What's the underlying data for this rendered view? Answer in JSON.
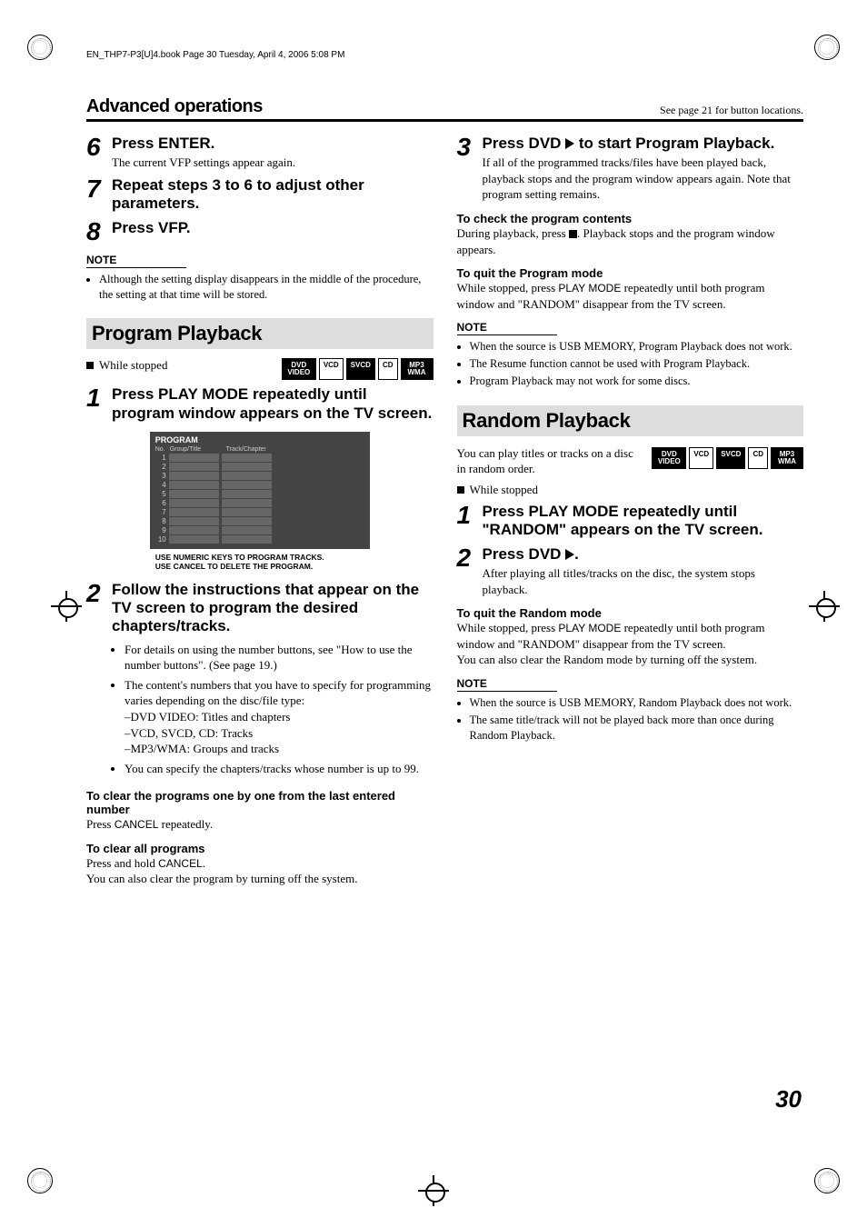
{
  "top_header": "EN_THP7-P3[U]4.book  Page 30  Tuesday, April 4, 2006  5:08 PM",
  "header": {
    "left": "Advanced operations",
    "right": "See page 21 for button locations."
  },
  "left_col": {
    "step6": {
      "num": "6",
      "title": "Press ENTER.",
      "sub": "The current VFP settings appear again."
    },
    "step7": {
      "num": "7",
      "title": "Repeat steps 3 to 6 to adjust other parameters."
    },
    "step8": {
      "num": "8",
      "title": "Press VFP."
    },
    "note_label": "NOTE",
    "note1_item": "Although the setting display disappears in the middle of the procedure, the setting at that time will be stored.",
    "program_banner": "Program Playback",
    "while_stopped": "While stopped",
    "badges": [
      "DVD VIDEO",
      "VCD",
      "SVCD",
      "CD",
      "MP3 WMA"
    ],
    "pstep1": {
      "num": "1",
      "title": "Press PLAY MODE repeatedly until program window appears on the TV screen."
    },
    "shot": {
      "title": "PROGRAM",
      "hdr_no": "No.",
      "hdr_grp": "Group/Title",
      "hdr_trk": "Track/Chapter",
      "caption1": "USE NUMERIC KEYS TO PROGRAM TRACKS.",
      "caption2": "USE CANCEL TO DELETE THE PROGRAM."
    },
    "pstep2": {
      "num": "2",
      "title": "Follow the instructions that appear on the TV screen to program the desired chapters/tracks.",
      "b1": "For details on using the number buttons, see \"How to use the number buttons\". (See page 19.)",
      "b2": "The content's numbers that you have to specify for programming varies depending on the disc/file type:",
      "b2a": "–DVD VIDEO: Titles and chapters",
      "b2b": "–VCD, SVCD, CD: Tracks",
      "b2c": "–MP3/WMA: Groups and tracks",
      "b3": "You can specify the chapters/tracks whose number is up to 99."
    },
    "clear_one_hd": "To clear the programs one by one from the last entered number",
    "clear_one_txt_a": "Press ",
    "clear_one_kw": "CANCEL",
    "clear_one_txt_b": " repeatedly.",
    "clear_all_hd": "To clear all programs",
    "clear_all_a": "Press and hold ",
    "clear_all_kw": "CANCEL",
    "clear_all_b": ".",
    "clear_all_c": "You can also clear the program by turning off the system."
  },
  "right_col": {
    "rstep3": {
      "num": "3",
      "title_a": "Press DVD ",
      "title_b": " to start Program Playback.",
      "sub": "If all of the programmed tracks/files have been played back, playback stops and the program window appears again. Note that program setting remains."
    },
    "check_hd": "To check the program contents",
    "check_a": "During playback, press ",
    "check_b": ". Playback stops and the program window appears.",
    "quit_prog_hd": "To quit the Program mode",
    "quit_prog_a": "While stopped, press ",
    "quit_prog_kw": "PLAY MODE",
    "quit_prog_b": " repeatedly until both program window and \"RANDOM\" disappear from the TV screen.",
    "note_label": "NOTE",
    "pn1": "When the source is USB MEMORY, Program Playback does not work.",
    "pn2": "The Resume function cannot be used with Program Playback.",
    "pn3": "Program Playback may not work for some discs.",
    "random_banner": "Random Playback",
    "random_intro": "You can play titles or tracks on a disc in random order.",
    "badges": [
      "DVD VIDEO",
      "VCD",
      "SVCD",
      "CD",
      "MP3 WMA"
    ],
    "while_stopped": "While stopped",
    "rnd1": {
      "num": "1",
      "title": "Press PLAY MODE repeatedly until \"RANDOM\" appears on the TV screen."
    },
    "rnd2": {
      "num": "2",
      "title_a": "Press DVD ",
      "title_b": ".",
      "sub": "After playing all titles/tracks on the disc, the system stops playback."
    },
    "quit_rnd_hd": "To quit the Random mode",
    "quit_rnd_a": "While stopped, press ",
    "quit_rnd_kw": "PLAY MODE",
    "quit_rnd_b": " repeatedly until both program window and \"RANDOM\" disappear from the TV screen.",
    "quit_rnd_c": "You can also clear the Random mode by turning off the system.",
    "rn1": "When the source is USB MEMORY, Random Playback does not work.",
    "rn2": "The same title/track will not be played back more than once during Random Playback."
  },
  "page_number": "30"
}
